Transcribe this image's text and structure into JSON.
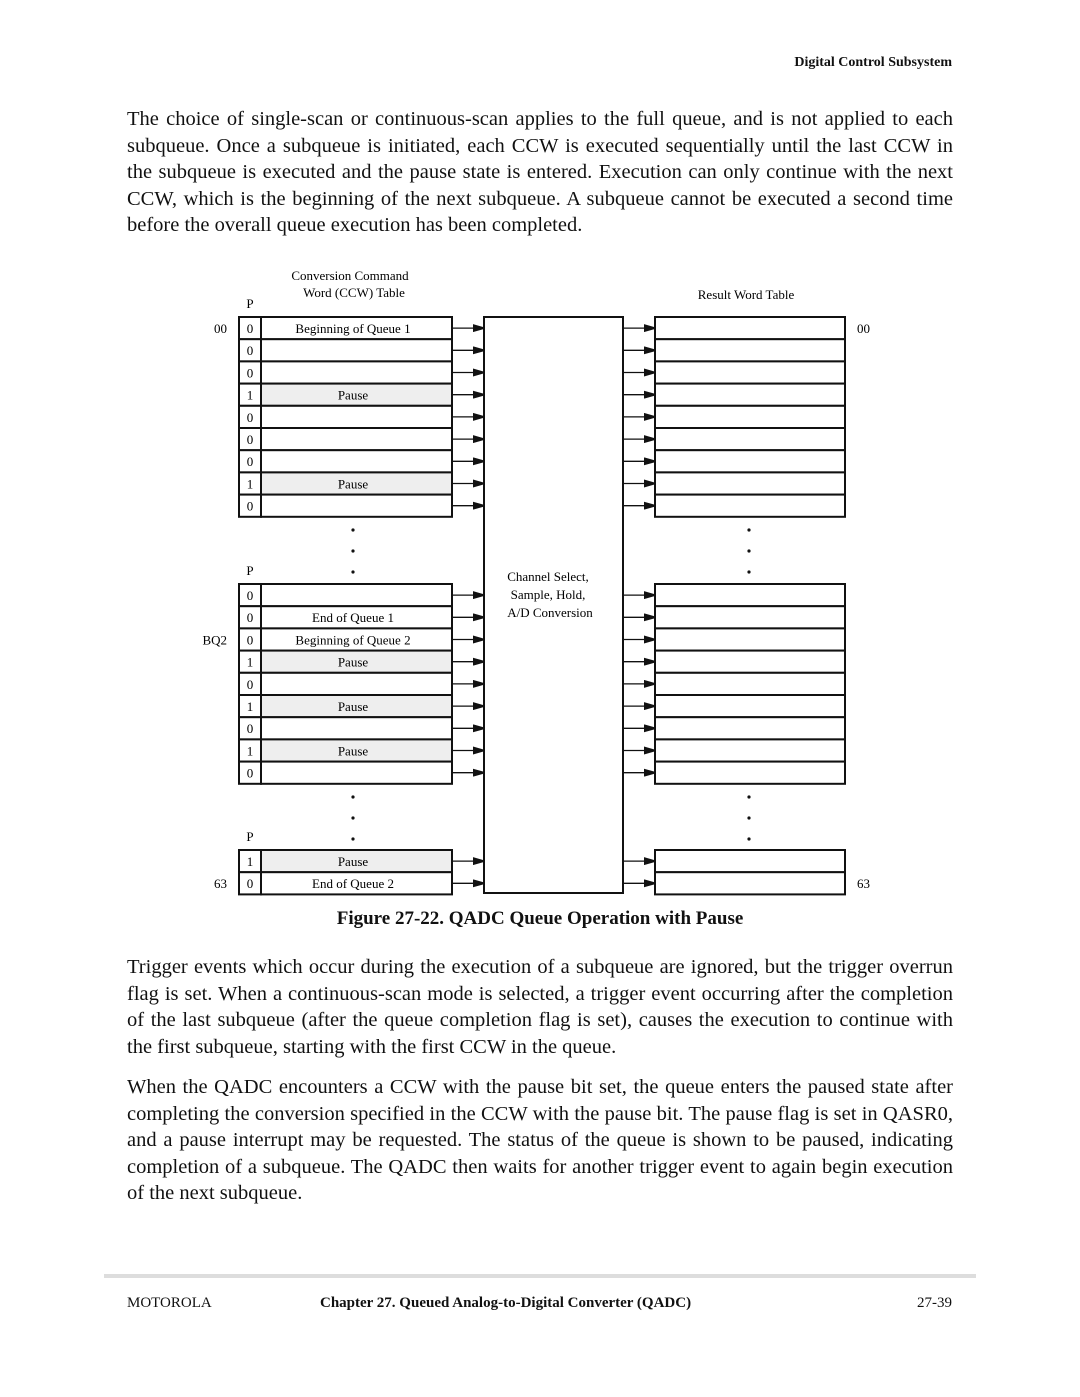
{
  "header": {
    "section": "Digital Control Subsystem"
  },
  "paragraphs": [
    "The choice of single-scan or continuous-scan applies to the full queue, and is not applied to each subqueue. Once a subqueue is initiated, each CCW is executed sequentially until the last CCW in the subqueue is executed and the pause state is entered. Execution can only continue with the next CCW, which is the beginning of the next subqueue. A subqueue cannot be executed a second time before the overall queue execution has been completed.",
    "Trigger events which occur during the execution of a subqueue are ignored, but the trigger overrun flag is set. When a continuous-scan mode is selected, a trigger event occurring after the completion of the last subqueue (after the queue completion flag is set), causes the execution to continue with the first subqueue, starting with the first CCW in the queue.",
    "When the QADC encounters a CCW with the pause bit set, the queue enters the paused state after completing the conversion specified in the CCW with the pause bit. The pause flag is set in QASR0, and a pause interrupt may be requested. The status of the queue is shown to be paused, indicating completion of a subqueue. The QADC then waits for another trigger event to again begin execution of the next subqueue."
  ],
  "figure": {
    "ccw_title_1": "Conversion Command",
    "ccw_title_2": "Word (CCW) Table",
    "result_title": "Result Word Table",
    "p_label": "P",
    "center_1": "Channel Select,",
    "center_2": "Sample, Hold,",
    "center_3": "A/D Conversion",
    "caption": "Figure 27-22. QADC Queue Operation with Pause",
    "groups": [
      {
        "rows": [
          {
            "p": "0",
            "label": "Beginning of Queue 1",
            "pause": false,
            "left": "00",
            "right": "00"
          },
          {
            "p": "0",
            "label": "",
            "pause": false
          },
          {
            "p": "0",
            "label": "",
            "pause": false
          },
          {
            "p": "1",
            "label": "Pause",
            "pause": true
          },
          {
            "p": "0",
            "label": "",
            "pause": false
          },
          {
            "p": "0",
            "label": "",
            "pause": false
          },
          {
            "p": "0",
            "label": "",
            "pause": false
          },
          {
            "p": "1",
            "label": "Pause",
            "pause": true
          },
          {
            "p": "0",
            "label": "",
            "pause": false
          }
        ]
      },
      {
        "rows": [
          {
            "p": "0",
            "label": "",
            "pause": false
          },
          {
            "p": "0",
            "label": "End of Queue 1",
            "pause": false
          },
          {
            "p": "0",
            "label": "Beginning of Queue 2",
            "pause": false,
            "left": "BQ2"
          },
          {
            "p": "1",
            "label": "Pause",
            "pause": true
          },
          {
            "p": "0",
            "label": "",
            "pause": false
          },
          {
            "p": "1",
            "label": "Pause",
            "pause": true
          },
          {
            "p": "0",
            "label": "",
            "pause": false
          },
          {
            "p": "1",
            "label": "Pause",
            "pause": true
          },
          {
            "p": "0",
            "label": "",
            "pause": false
          }
        ]
      },
      {
        "rows": [
          {
            "p": "1",
            "label": "Pause",
            "pause": true
          },
          {
            "p": "0",
            "label": "End of Queue 2",
            "pause": false,
            "left": "63",
            "right": "63"
          }
        ]
      }
    ]
  },
  "footer": {
    "left": "MOTOROLA",
    "center": "Chapter 27.  Queued Analog-to-Digital Converter (QADC)",
    "right": "27-39"
  }
}
